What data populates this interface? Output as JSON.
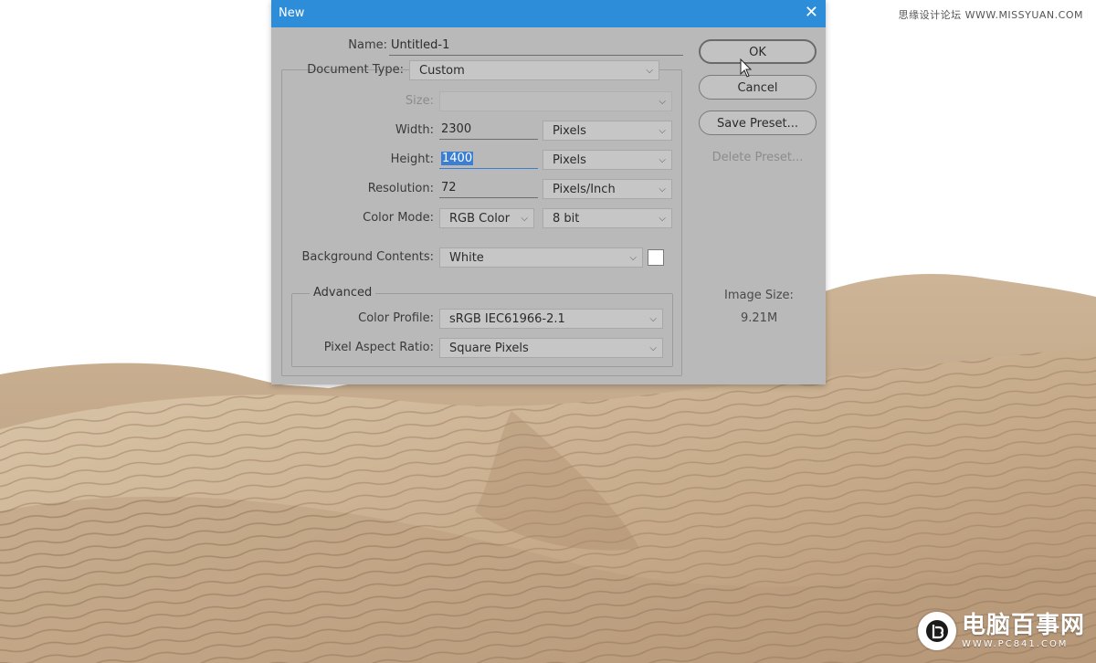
{
  "dialog": {
    "title": "New",
    "name_label": "Name:",
    "name_value": "Untitled-1",
    "document_type_label": "Document Type:",
    "document_type_value": "Custom",
    "size_label": "Size:",
    "size_value": "",
    "width_label": "Width:",
    "width_value": "2300",
    "width_unit": "Pixels",
    "height_label": "Height:",
    "height_value": "1400",
    "height_unit": "Pixels",
    "resolution_label": "Resolution:",
    "resolution_value": "72",
    "resolution_unit": "Pixels/Inch",
    "color_mode_label": "Color Mode:",
    "color_mode_value": "RGB Color",
    "bit_depth_value": "8 bit",
    "background_label": "Background Contents:",
    "background_value": "White",
    "advanced_title": "Advanced",
    "color_profile_label": "Color Profile:",
    "color_profile_value": "sRGB IEC61966-2.1",
    "pixel_aspect_label": "Pixel Aspect Ratio:",
    "pixel_aspect_value": "Square Pixels",
    "image_size_label": "Image Size:",
    "image_size_value": "9.21M",
    "buttons": {
      "ok": "OK",
      "cancel": "Cancel",
      "save_preset": "Save Preset...",
      "delete_preset": "Delete Preset..."
    },
    "close_glyph": "✕"
  },
  "watermarks": {
    "top": "思缘设计论坛 WWW.MISSYUAN.COM",
    "bottom_cn": "电脑百事网",
    "bottom_url": "WWW.PC841.COM"
  },
  "colors": {
    "titlebar": "#2e8dd8",
    "dialog_bg": "#b9b9b9",
    "selection": "#3b7fd4",
    "sand_light": "#d8c4a8",
    "sand_dark": "#a88e6e"
  }
}
